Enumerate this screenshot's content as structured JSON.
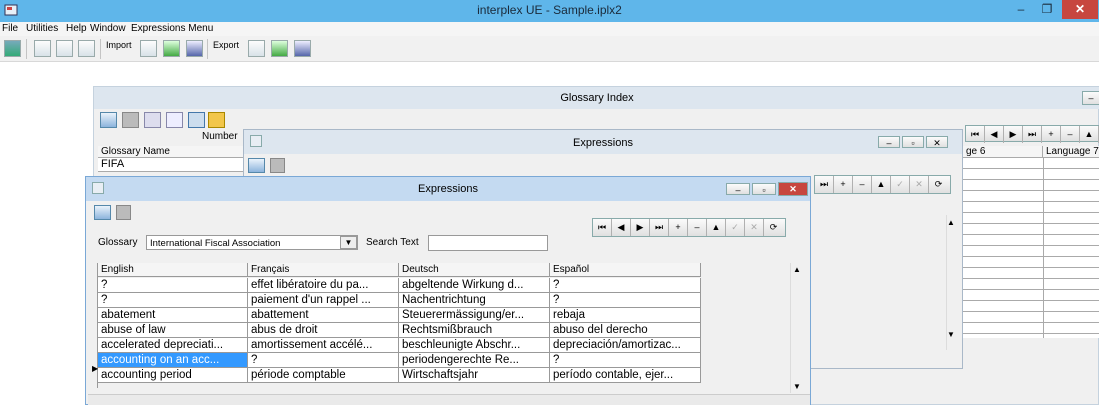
{
  "app": {
    "title": "interplex UE - Sample.iplx2",
    "min": "–",
    "max": "❐",
    "close": "✕"
  },
  "menu": [
    "File",
    "Utilities",
    "Help",
    "Window",
    "Expressions Menu"
  ],
  "toolbar": {
    "import_label": "Import",
    "export_label": "Export"
  },
  "glossary_index": {
    "title": "Glossary Index",
    "number_label": "Number",
    "glossary_name_header": "Glossary Name",
    "first_row": "FIFA",
    "language_headers": [
      "ge 6",
      "Language 7"
    ],
    "nav": [
      "⏮",
      "◀",
      "▶",
      "⏭",
      "+",
      "–",
      "▲"
    ]
  },
  "expressions_back": {
    "title": "Expressions",
    "nav": [
      "⏭",
      "+",
      "–",
      "▲",
      "✓",
      "✕",
      "⟳"
    ]
  },
  "expressions_front": {
    "title": "Expressions",
    "glossary_label": "Glossary",
    "glossary_value": "International Fiscal Association",
    "search_label": "Search Text",
    "search_value": "",
    "nav": [
      "⏮",
      "◀",
      "▶",
      "⏭",
      "+",
      "–",
      "▲",
      "✓",
      "✕",
      "⟳"
    ],
    "columns": [
      "English",
      "Français",
      "Deutsch",
      "Español"
    ],
    "rows": [
      [
        "?",
        "effet libératoire du pa...",
        "abgeltende Wirkung d...",
        "?"
      ],
      [
        "?",
        "paiement d'un rappel ...",
        "Nachentrichtung",
        "?"
      ],
      [
        "abatement",
        "abattement",
        "Steuerermässigung/er...",
        "rebaja"
      ],
      [
        "abuse of law",
        "abus de droit",
        "Rechtsmißbrauch",
        "abuso del derecho"
      ],
      [
        "accelerated depreciati...",
        "amortissement accélé...",
        "beschleunigte Abschr...",
        "depreciación/amortizac..."
      ],
      [
        "accounting on an acc...",
        "?",
        "periodengerechte Re...",
        "?"
      ],
      [
        "accounting period",
        "période comptable",
        "Wirtschaftsjahr",
        "período contable, ejer..."
      ]
    ],
    "selected_row": 5
  },
  "colors": {
    "titlebar": "#5fb6ea",
    "selection": "#3399ff",
    "close": "#c7463f"
  }
}
